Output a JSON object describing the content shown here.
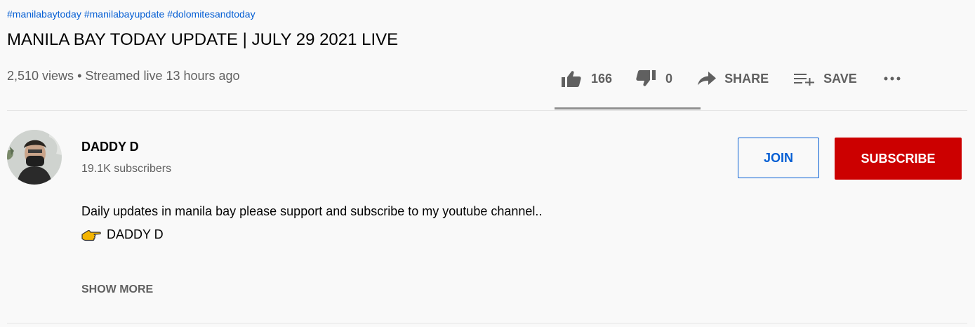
{
  "video": {
    "hashtags": [
      "#manilabaytoday",
      "#manilabayupdate",
      "#dolomitesandtoday"
    ],
    "title": "MANILA BAY TODAY UPDATE | JULY 29 2021 LIVE",
    "views": "2,510 views",
    "separator": "•",
    "streamed": "Streamed live 13 hours ago"
  },
  "actions": {
    "likes": "166",
    "dislikes": "0",
    "share_label": "SHARE",
    "save_label": "SAVE",
    "more_label": "..."
  },
  "ratings": {
    "like_ratio": 1.0
  },
  "channel": {
    "name": "DADDY D",
    "subscribers": "19.1K subscribers",
    "join_label": "JOIN",
    "subscribe_label": "SUBSCRIBE"
  },
  "description": {
    "line1": "Daily updates in manila bay please support and subscribe to my youtube channel..",
    "signature_icon": "pointing-hand-icon",
    "signature": "DADDY D",
    "show_more_label": "SHOW MORE"
  },
  "colors": {
    "link": "#065fd4",
    "subscribe_bg": "#cc0000",
    "text_secondary": "#606060"
  }
}
